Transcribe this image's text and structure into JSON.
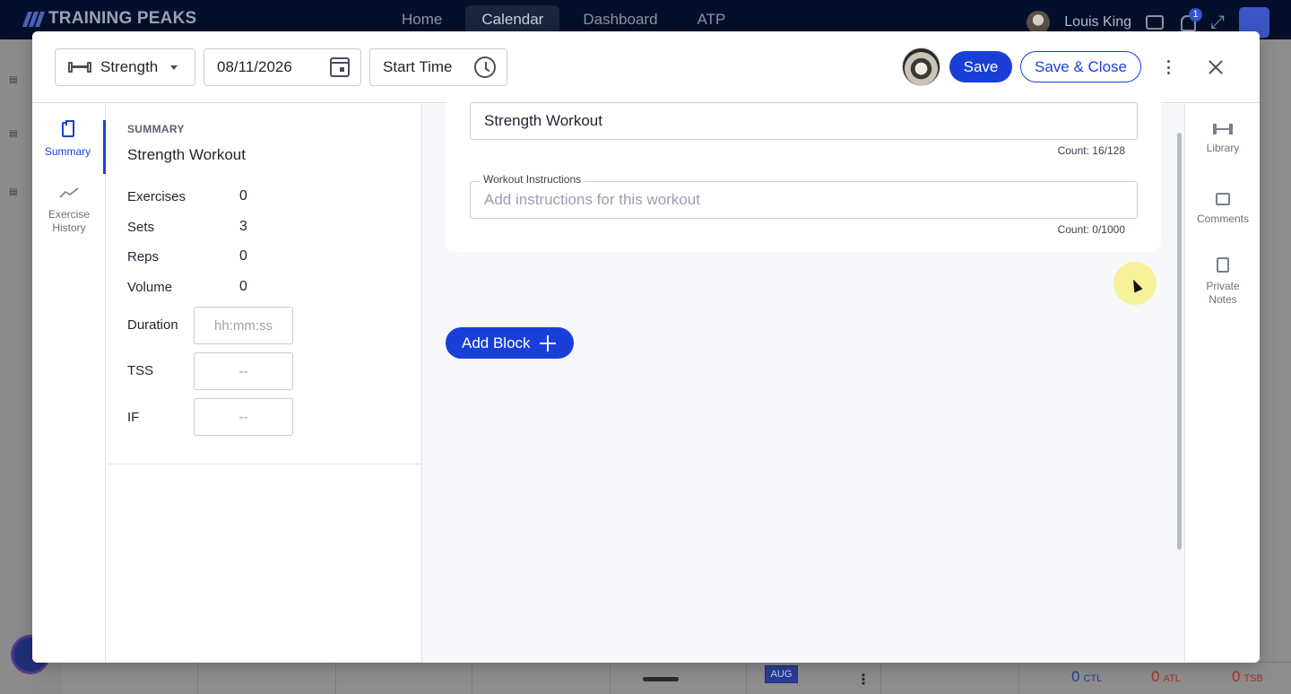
{
  "app": {
    "brand": "TRAINING PEAKS",
    "nav": [
      "Home",
      "Calendar",
      "Dashboard",
      "ATP"
    ],
    "active_nav": "Calendar",
    "user_name": "Louis King",
    "notification_count": "1"
  },
  "background": {
    "month_chip": "AUG",
    "metrics": {
      "ctl_value": "0",
      "ctl_label": "CTL",
      "atl_value": "0",
      "atl_label": "ATL",
      "tsb_value": "0",
      "tsb_label": "TSB"
    }
  },
  "modal": {
    "header": {
      "workout_type": "Strength",
      "date": "08/11/2026",
      "start_time_label": "Start Time",
      "save_label": "Save",
      "save_close_label": "Save & Close"
    },
    "side_tabs": [
      {
        "label": "Summary",
        "active": true
      },
      {
        "label": "Exercise History",
        "active": false
      }
    ],
    "summary": {
      "heading": "SUMMARY",
      "title": "Strength Workout",
      "stats": [
        {
          "label": "Exercises",
          "value": "0"
        },
        {
          "label": "Sets",
          "value": "3"
        },
        {
          "label": "Reps",
          "value": "0"
        },
        {
          "label": "Volume",
          "value": "0"
        }
      ],
      "inputs": [
        {
          "label": "Duration",
          "placeholder": "hh:mm:ss"
        },
        {
          "label": "TSS",
          "placeholder": "--"
        },
        {
          "label": "IF",
          "placeholder": "--"
        }
      ]
    },
    "workout_form": {
      "title_value": "Strength Workout",
      "title_count": "Count: 16/128",
      "instructions_label": "Workout Instructions",
      "instructions_placeholder": "Add instructions for this workout",
      "instructions_count": "Count: 0/1000",
      "add_block_label": "Add Block"
    },
    "right_rail": [
      {
        "label": "Library",
        "icon": "dumbbell-icon"
      },
      {
        "label": "Comments",
        "icon": "comment-icon"
      },
      {
        "label": "Private Notes",
        "icon": "private-notes-icon"
      }
    ]
  }
}
